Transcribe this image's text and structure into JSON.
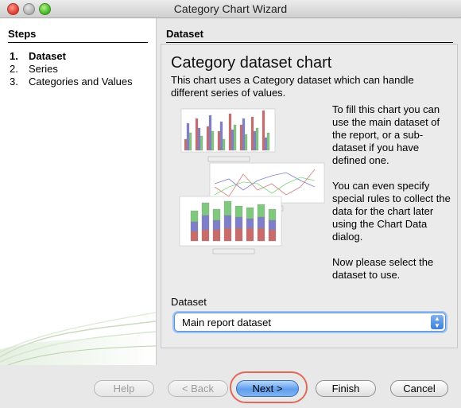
{
  "window": {
    "title": "Category Chart Wizard"
  },
  "steps": {
    "heading": "Steps",
    "items": [
      {
        "num": "1.",
        "label": "Dataset",
        "active": true
      },
      {
        "num": "2.",
        "label": "Series",
        "active": false
      },
      {
        "num": "3.",
        "label": "Categories and Values",
        "active": false
      }
    ]
  },
  "panel": {
    "heading": "Dataset",
    "title": "Category dataset chart",
    "subtitle": "This chart uses a Category dataset which can handle different series of values.",
    "desc1": "To fill this chart you can use the main dataset of the report, or a sub-dataset if you have defined one.",
    "desc2": "You can even specify special rules to collect the data for the chart later using the Chart Data dialog.",
    "desc3": "Now please select the dataset to use."
  },
  "dataset": {
    "label": "Dataset",
    "selected": "Main report dataset"
  },
  "buttons": {
    "help": "Help",
    "back": "< Back",
    "next": "Next >",
    "finish": "Finish",
    "cancel": "Cancel"
  }
}
